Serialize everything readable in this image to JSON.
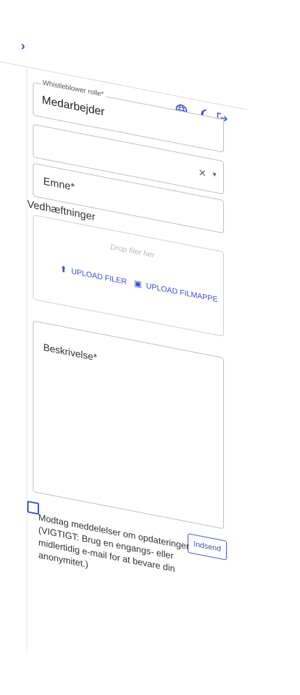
{
  "header": {
    "expand_icon": "chevron-right-icon"
  },
  "toolbar": {
    "icons": [
      "globe-icon",
      "moon-icon",
      "logout-icon"
    ]
  },
  "form": {
    "role": {
      "legend": "Whistleblower rolle*",
      "value": "Medarbejder"
    },
    "select": {
      "clear_symbol": "✕",
      "caret_symbol": "▾"
    },
    "subject": {
      "label": "Emne*"
    },
    "attachments": {
      "label": "Vedhæftninger",
      "drop_text": "Drop filer her",
      "upload_files": "UPLOAD FILER",
      "upload_folder": "UPLOAD FILMAPPE"
    },
    "description": {
      "label": "Beskrivelse*"
    },
    "consent": {
      "text": "Modtag meddelelser om opdateringer (VIGTIGT: Brug en engangs- eller midlertidig e-mail for at bevare din anonymitet.)",
      "checked": false
    },
    "submit_label": "Indsend"
  },
  "colors": {
    "accent": "#3b4fd0",
    "border": "#bdbdbd"
  }
}
